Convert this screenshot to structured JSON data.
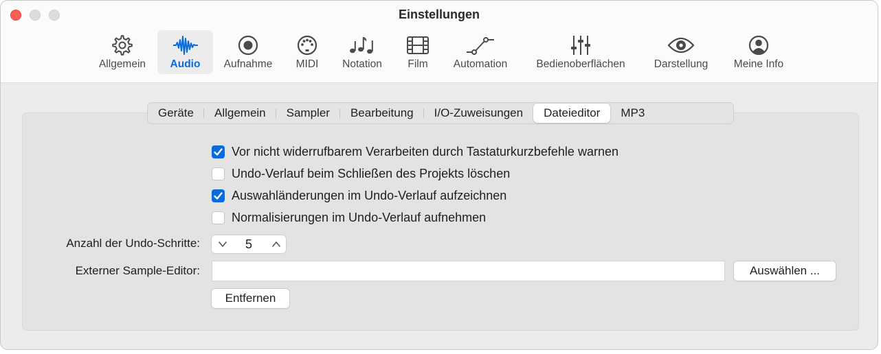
{
  "window": {
    "title": "Einstellungen"
  },
  "toolbar": {
    "items": [
      {
        "label": "Allgemein",
        "icon": "gear-icon"
      },
      {
        "label": "Audio",
        "icon": "waveform-icon",
        "active": true
      },
      {
        "label": "Aufnahme",
        "icon": "record-icon"
      },
      {
        "label": "MIDI",
        "icon": "midi-port-icon"
      },
      {
        "label": "Notation",
        "icon": "music-notes-icon"
      },
      {
        "label": "Film",
        "icon": "film-icon"
      },
      {
        "label": "Automation",
        "icon": "automation-curve-icon"
      },
      {
        "label": "Bedienoberflächen",
        "icon": "faders-icon"
      },
      {
        "label": "Darstellung",
        "icon": "eye-icon"
      },
      {
        "label": "Meine Info",
        "icon": "person-icon"
      }
    ],
    "accent_color": "#0a6cdb"
  },
  "tabs": {
    "items": [
      "Geräte",
      "Allgemein",
      "Sampler",
      "Bearbeitung",
      "I/O-Zuweisungen",
      "Dateieditor",
      "MP3"
    ],
    "selected": "Dateieditor"
  },
  "options": [
    {
      "label": "Vor nicht widerrufbarem Verarbeiten durch Tastaturkurzbefehle warnen",
      "checked": true
    },
    {
      "label": "Undo-Verlauf beim Schließen des Projekts löschen",
      "checked": false
    },
    {
      "label": "Auswahländerungen im Undo-Verlauf aufzeichnen",
      "checked": true
    },
    {
      "label": "Normalisierungen im Undo-Verlauf aufnehmen",
      "checked": false
    }
  ],
  "undo_steps": {
    "label": "Anzahl der Undo-Schritte:",
    "value": "5"
  },
  "external_editor": {
    "label": "Externer Sample-Editor:",
    "value": "",
    "choose_label": "Auswählen ...",
    "remove_label": "Entfernen"
  }
}
